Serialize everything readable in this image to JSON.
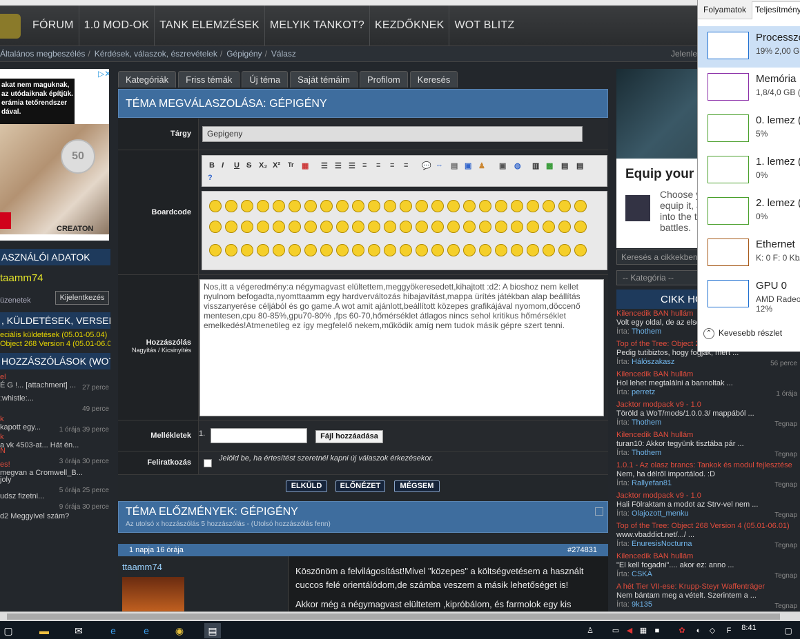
{
  "nav": {
    "items": [
      "FÓRUM",
      "1.0 MOD-OK",
      "TANK ELEMZÉSEK",
      "MELYIK TANKOT?",
      "KEZDŐKNEK",
      "WOT BLITZ"
    ]
  },
  "breadcrumb": {
    "items": [
      "Általános megbeszélés",
      "Kérdések, válaszok, észrevételek",
      "Gépigény",
      "Válasz"
    ],
    "right": "Jelenleg"
  },
  "left": {
    "ad_text": "akat nem maguknak, az utódaiknak építjük. erámia tetőrendszer dával.",
    "ad_seal": "50",
    "ad_brand": "CREATON",
    "user_head": "ASZNÁLÓI ADATOK",
    "username": "taamm74",
    "messages": "üzenetek",
    "logout": "Kijelentkezés",
    "quests_head": ", KÜLDETÉSEK, VERSENYEK",
    "quests": [
      "eciális küldetések (05.01-05.04)",
      "Object 268 Version 4 (05.01-06.0"
    ],
    "posts_head": "HOZZÁSZÓLÁSOK (WOT)",
    "posts": [
      {
        "title": "el",
        "text": "É G !... [attachment] ...",
        "time": "27 perce"
      },
      {
        "title": "",
        "text": ":whistle:...",
        "time": "49 perce"
      },
      {
        "title": "k",
        "text": "kapott egy...",
        "time": "1 órája 39 perce"
      },
      {
        "title": "k",
        "text": "a vk 4503-at... Hát én...",
        "time": ""
      },
      {
        "title": "N",
        "text": "",
        "time": "3 órája 30 perce"
      },
      {
        "title": "es!",
        "text": "megvan a Cromwell_B...",
        "time": ""
      },
      {
        "title": "",
        "text": "joly",
        "time": "5 órája 25 perce"
      },
      {
        "title": "",
        "text": "udsz fizetni...",
        "time": "9 órája 30 perce"
      },
      {
        "title": "",
        "text": "d2 Meggyivel szám?",
        "time": ""
      }
    ]
  },
  "tabs": [
    "Kategóriák",
    "Friss témák",
    "Új téma",
    "Saját témáim",
    "Profilom",
    "Keresés"
  ],
  "form": {
    "title": "TÉMA MEGVÁLASZOLÁSA: GÉPIGÉNY",
    "subject_label": "Tárgy",
    "subject_value": "Gepigeny",
    "boardcode_label": "Boardcode",
    "message_label": "Hozzászólás",
    "message_sub": "Nagyítás / Kicsinyítés",
    "message_text": "Nos,itt a végeredmény:a négymagvast elültettem,meggyökeresedett,kihajtott :d2:  A bioshoz nem kellet nyulnom befogadta,nyomttaamm egy hardverváltozás hibajavítást,mappa ürítés játékban alap beállítás visszanyerése céljából és go game.A wot amit ajánlott,beállított közepes grafikájával nyomom,döccenő mentesen,cpu 80-85%,gpu70-80% ,fps 60-70,hőmérséklet átlagos nincs sehol kritikus hőmérséklet emelkedés!Atmenetileg ez így megfelelő nekem,működik amíg nem tudok másik gépre szert tenni.",
    "attach_label": "Mellékletek",
    "attach_num": "1.",
    "attach_button": "Fájl hozzáadása",
    "subscribe_label": "Feliratkozás",
    "subscribe_text": "Jelöld be, ha értesítést szeretnél kapni új válaszok érkezésekor.",
    "submit": "ELKÜLD",
    "preview": "ELŐNÉZET",
    "cancel": "MÉGSEM"
  },
  "history": {
    "title": "TÉMA ELŐZMÉNYEK: GÉPIGÉNY",
    "subtitle": "Az utolsó x hozzászólás 5 hozzászólás - (Utolsó hozzászólás fenn)",
    "post_time": "1 napja 16 órája",
    "post_id": "#274831",
    "author": "ttaamm74",
    "body": "Köszönöm a felvilágosítást!Mivel \"közepes\" a költségvetésem a használt cuccos felé orientálódom,de számba veszem a másik lehetőséget is!",
    "body2": "Akkor még a négymagvast elültetem ,kipróbálom, és farmolok egy kis"
  },
  "right": {
    "ad_title": "Equip your",
    "ad_body": [
      "Choose y",
      "equip it, a",
      "into the t",
      "battles."
    ],
    "search_placeholder": "Keresés a cikkekben",
    "category": "-- Kategória --",
    "head": "CIKK HOZ",
    "items": [
      {
        "a": "Kilencedik BAN hullám",
        "b": "Volt egy oldal, de az elsé",
        "u": "Thothem",
        "d": ""
      },
      {
        "a": "Top of the Tree: Object 2",
        "b": "Pedig tutibiztos, hogy fogjak, mert ...",
        "u": "Hálószakasz",
        "d": "56 perce"
      },
      {
        "a": "Kilencedik BAN hullám",
        "b": "Hol lehet megtalálni a bannoltak ...",
        "u": "perretz",
        "d": "1 órája"
      },
      {
        "a": "Jacktor modpack v9 - 1.0",
        "b": "Töröld a WoT/mods/1.0.0.3/ mappából ...",
        "u": "Thothem",
        "d": "Tegnap"
      },
      {
        "a": "Kilencedik BAN hullám",
        "b": "turan10: Akkor tegyünk tisztába pár ...",
        "u": "Thothem",
        "d": "Tegnap"
      },
      {
        "a": "1.0.1 - Az olasz brancs: Tankok és modul fejlesztése",
        "b": "Nem, ha délről importálod. :D",
        "u": "Rallyefan81",
        "d": "Tegnap"
      },
      {
        "a": "Jacktor modpack v9 - 1.0",
        "b": "Hali Fölraktam a modot az Strv-vel nem ...",
        "u": "Olajozott_menku",
        "d": "Tegnap"
      },
      {
        "a": "Top of the Tree: Object 268 Version 4 (05.01-06.01)",
        "b": "www.vbaddict.net/.../ ...",
        "u": "EnuresisNocturna",
        "d": "Tegnap"
      },
      {
        "a": "Kilencedik BAN hullám",
        "b": "\"El kell fogadni\".... akor ez: anno ...",
        "u": "CSKA",
        "d": "Tegnap"
      },
      {
        "a": "A hét Tier VII-ese: Krupp-Steyr Waffenträger",
        "b": "Nem bántam meg a vételt. Szerintem a ...",
        "u": "9k135",
        "d": "Tegnap"
      }
    ],
    "by": "Írta: "
  },
  "taskmgr": {
    "tab1": "Folyamatok",
    "tab2": "Teljesítmény",
    "items": [
      {
        "name": "Processzo",
        "val": "19% 2,00 GH",
        "color": "#1e6fd0"
      },
      {
        "name": "Memória",
        "val": "1,8/4,0 GB (4",
        "color": "#8b2fa8"
      },
      {
        "name": "0. lemez (",
        "val": "5%",
        "color": "#4aa02c"
      },
      {
        "name": "1. lemez (",
        "val": "0%",
        "color": "#4aa02c"
      },
      {
        "name": "2. lemez (",
        "val": "0%",
        "color": "#4aa02c"
      },
      {
        "name": "Ethernet",
        "val": "K: 0 F: 0 Kb/",
        "color": "#a75a1a"
      },
      {
        "name": "GPU 0",
        "val": "AMD Radeo\n12%",
        "color": "#1e6fd0"
      }
    ],
    "fewer": "Kevesebb részlet"
  },
  "taskbar": {
    "time": "8:41"
  }
}
